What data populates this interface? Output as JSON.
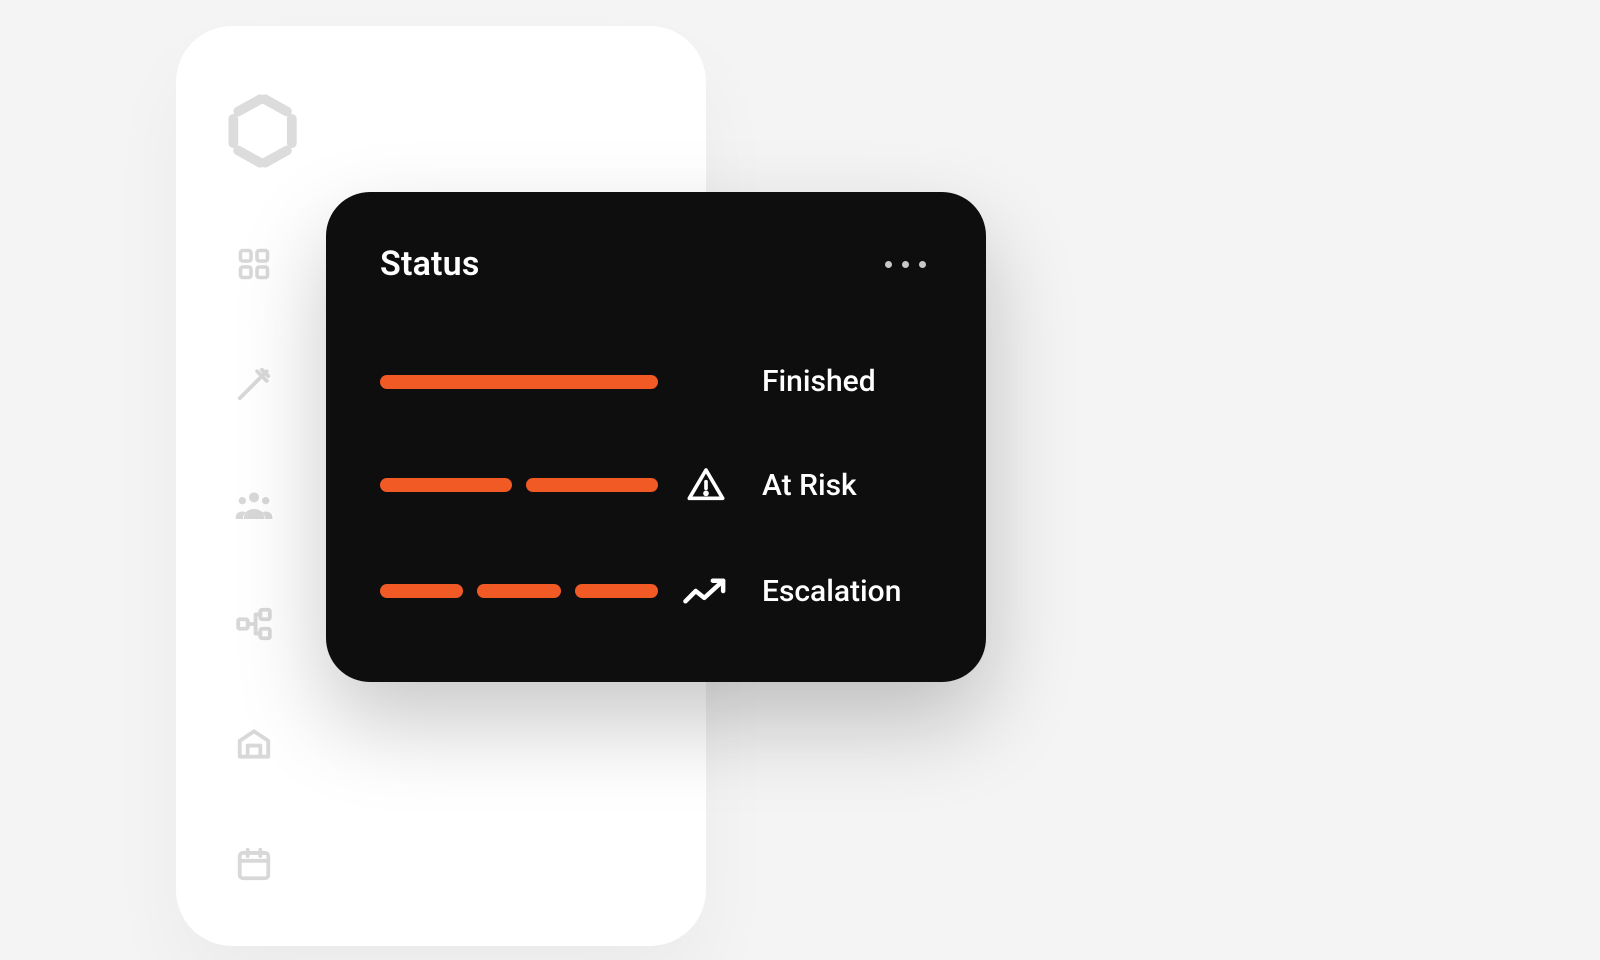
{
  "colors": {
    "accent": "#f15a24",
    "card_bg": "#0e0e0e",
    "sidebar_bg": "#ffffff",
    "page_bg": "#f4f4f4",
    "muted_icon": "#d8d8d8"
  },
  "sidebar": {
    "logo_icon": "aperture-logo",
    "items": [
      {
        "icon": "dashboard-icon"
      },
      {
        "icon": "tools-icon"
      },
      {
        "icon": "people-icon"
      },
      {
        "icon": "nodes-icon"
      },
      {
        "icon": "garage-icon"
      },
      {
        "icon": "calendar-icon"
      }
    ]
  },
  "status_card": {
    "title": "Status",
    "menu_icon": "more-horizontal-icon",
    "rows": [
      {
        "label": "Finished",
        "icon": null,
        "segments": 1
      },
      {
        "label": "At Risk",
        "icon": "warning-triangle-icon",
        "segments": 2
      },
      {
        "label": "Escalation",
        "icon": "trend-up-icon",
        "segments": 3
      }
    ]
  }
}
